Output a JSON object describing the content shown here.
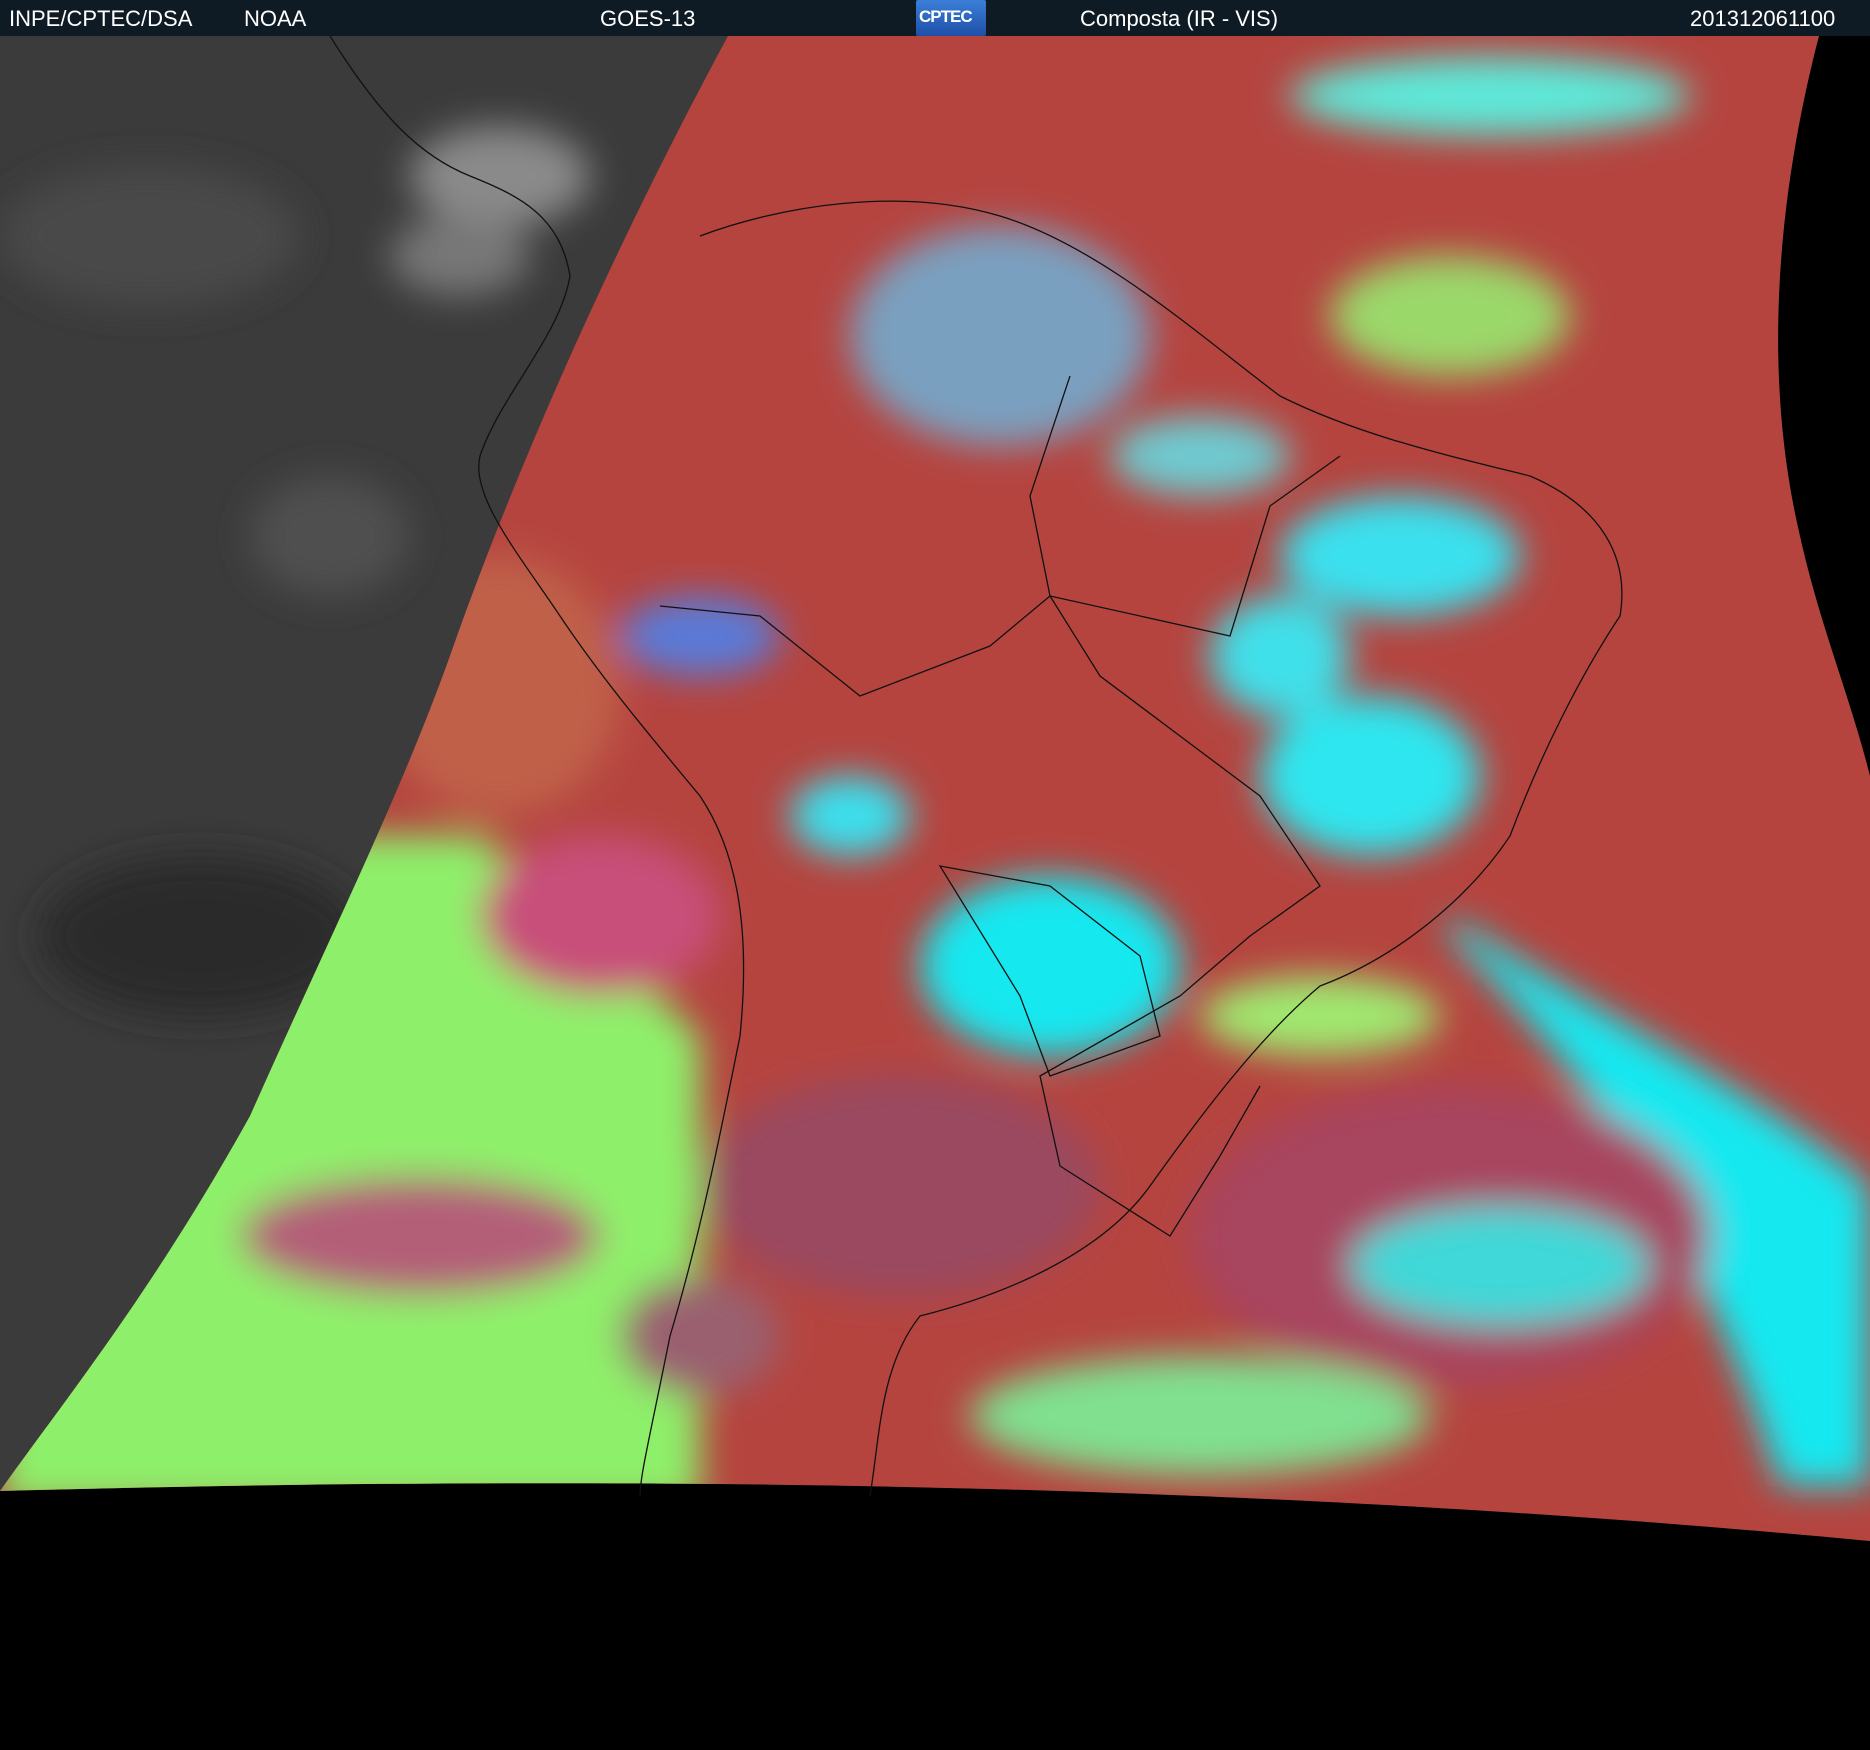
{
  "header": {
    "institution": "INPE/CPTEC/DSA",
    "agency": "NOAA",
    "satellite": "GOES-13",
    "logo_text": "CPTEC",
    "product": "Composta (IR - VIS)",
    "timestamp": "201312061100"
  },
  "colors": {
    "header_bg": "#0f1b24",
    "land_red": "#b5443f",
    "cloud_cyan": "#19e8f0",
    "low_cloud_green": "#8ef06a",
    "night_gray": "#3a3a3a"
  }
}
